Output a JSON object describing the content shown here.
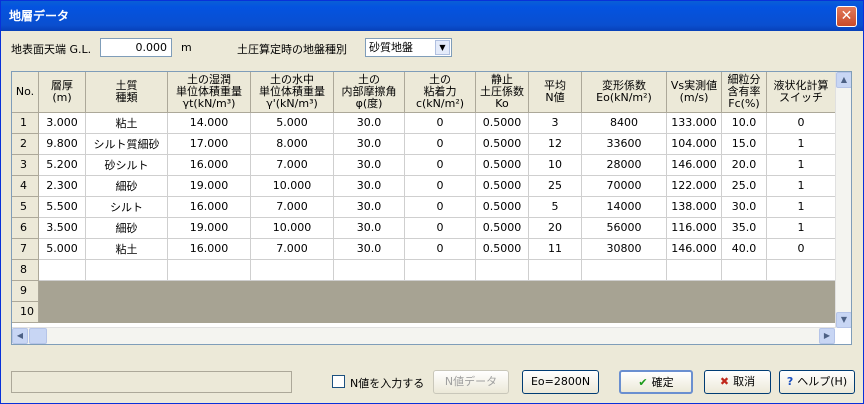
{
  "window": {
    "title": "地層データ"
  },
  "header": {
    "surface_label": "地表面天端 G.L.",
    "surface_value": "0.000",
    "surface_unit": "m",
    "ground_type_label": "土圧算定時の地盤種別",
    "ground_type_value": "砂質地盤"
  },
  "grid": {
    "columns": [
      "No.",
      "層厚\n(m)",
      "土質\n種類",
      "土の湿潤\n単位体積重量\nγt(kN/m³)",
      "土の水中\n単位体積重量\nγ'(kN/m³)",
      "土の\n内部摩擦角\nφ(度)",
      "土の\n粘着力\nc(kN/m²)",
      "静止\n土圧係数\nKo",
      "平均\nN値",
      "変形係数\nEo(kN/m²)",
      "Vs実測値\n(m/s)",
      "細粒分\n含有率\nFc(%)",
      "液状化計算\nスイッチ"
    ],
    "rows": [
      [
        "1",
        "3.000",
        "粘土",
        "14.000",
        "5.000",
        "30.0",
        "0",
        "0.5000",
        "3",
        "8400",
        "133.000",
        "10.0",
        "0"
      ],
      [
        "2",
        "9.800",
        "シルト質細砂",
        "17.000",
        "8.000",
        "30.0",
        "0",
        "0.5000",
        "12",
        "33600",
        "104.000",
        "15.0",
        "1"
      ],
      [
        "3",
        "5.200",
        "砂シルト",
        "16.000",
        "7.000",
        "30.0",
        "0",
        "0.5000",
        "10",
        "28000",
        "146.000",
        "20.0",
        "1"
      ],
      [
        "4",
        "2.300",
        "細砂",
        "19.000",
        "10.000",
        "30.0",
        "0",
        "0.5000",
        "25",
        "70000",
        "122.000",
        "25.0",
        "1"
      ],
      [
        "5",
        "5.500",
        "シルト",
        "16.000",
        "7.000",
        "30.0",
        "0",
        "0.5000",
        "5",
        "14000",
        "138.000",
        "30.0",
        "1"
      ],
      [
        "6",
        "3.500",
        "細砂",
        "19.000",
        "10.000",
        "30.0",
        "0",
        "0.5000",
        "20",
        "56000",
        "116.000",
        "35.0",
        "1"
      ],
      [
        "7",
        "5.000",
        "粘土",
        "16.000",
        "7.000",
        "30.0",
        "0",
        "0.5000",
        "11",
        "30800",
        "146.000",
        "40.0",
        "0"
      ],
      [
        "8",
        "",
        "",
        "",
        "",
        "",
        "",
        "",
        "",
        "",
        "",
        "",
        ""
      ],
      [
        "9",
        "",
        "",
        "",
        "",
        "",
        "",
        "",
        "",
        "",
        "",
        "",
        ""
      ],
      [
        "10",
        "",
        "",
        "",
        "",
        "",
        "",
        "",
        "",
        "",
        "",
        "",
        ""
      ]
    ]
  },
  "footer": {
    "n_value_checkbox_label": "N値を入力する",
    "n_data_button": "N値データ",
    "eo_button": "Eo=2800N",
    "ok_button": "確定",
    "cancel_button": "取消",
    "help_button": "ヘルプ(H)"
  }
}
